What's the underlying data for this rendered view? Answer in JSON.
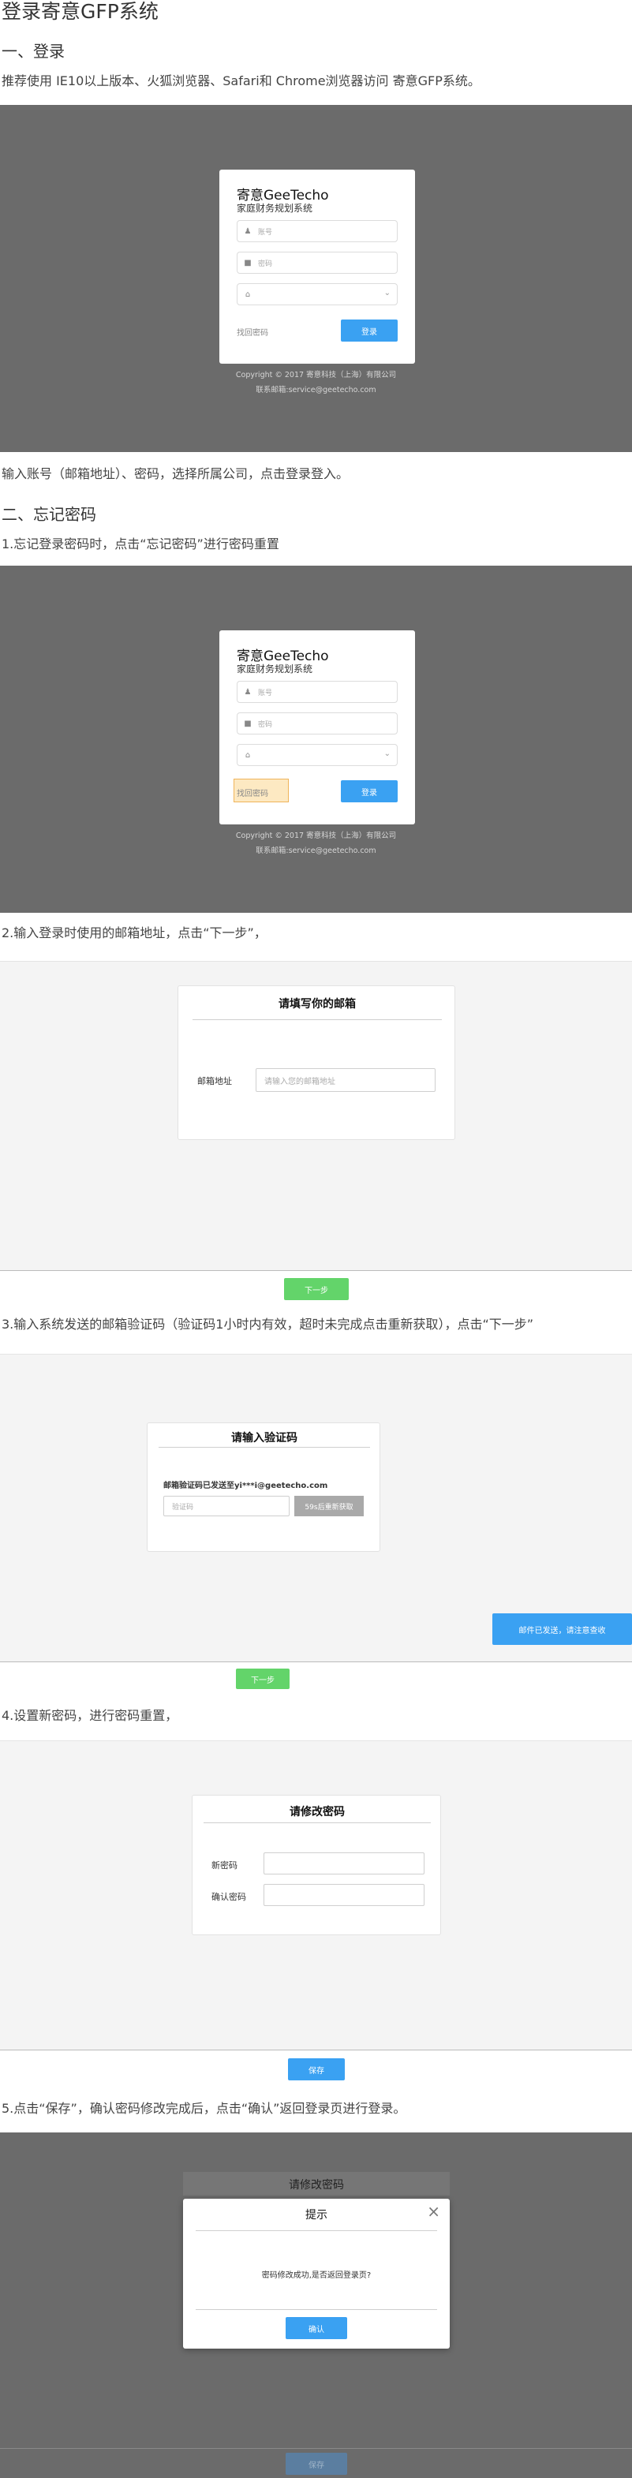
{
  "doc": {
    "title": "登录寄意GFP系统",
    "sec1_heading": "一、登录",
    "sec1_intro": "推荐使用 IE10以上版本、火狐浏览器、Safari和 Chrome浏览器访问 寄意GFP系统。",
    "sec1_after": "输入账号（邮箱地址）、密码，选择所属公司，点击登录登入。",
    "sec2_heading": "二、忘记密码",
    "step1": "1.忘记登录密码时，点击“忘记密码”进行密码重置",
    "step2": "2.输入登录时使用的邮箱地址，点击“下一步”，",
    "step3": "3.输入系统发送的邮箱验证码（验证码1小时内有效，超时未完成点击重新获取），点击“下一步”",
    "step4": "4.设置新密码，进行密码重置，",
    "step5": "5.点击“保存”，确认密码修改完成后，点击“确认”返回登录页进行登录。"
  },
  "login": {
    "brand": "寄意GeeTecho",
    "subtitle": "家庭财务规划系统",
    "account_placeholder": "账号",
    "password_placeholder": "密码",
    "forgot_link": "找回密码",
    "login_button": "登录",
    "copyright": "Copyright © 2017 寄意科技（上海）有限公司",
    "contact": "联系邮箱:service@geetecho.com"
  },
  "email_step": {
    "title": "请填写你的邮箱",
    "label": "邮箱地址",
    "placeholder": "请输入您的邮箱地址",
    "next_button": "下一步"
  },
  "code_step": {
    "title": "请输入验证码",
    "sent_text": "邮箱验证码已发送至yi***i@geetecho.com",
    "placeholder": "验证码",
    "resend_button": "59s后重新获取",
    "toast": "邮件已发送，请注意查收",
    "next_button": "下一步"
  },
  "reset_step": {
    "title": "请修改密码",
    "new_label": "新密码",
    "confirm_label": "确认密码",
    "save_button": "保存"
  },
  "confirm_step": {
    "bg_title": "请修改密码",
    "dialog_title": "提示",
    "message": "密码修改成功,是否返回登录页?",
    "confirm_button": "确认",
    "bg_save": "保存"
  },
  "colors": {
    "primary": "#3aa1f2",
    "success": "#63d46a",
    "overlay": "#6b6b6b"
  }
}
